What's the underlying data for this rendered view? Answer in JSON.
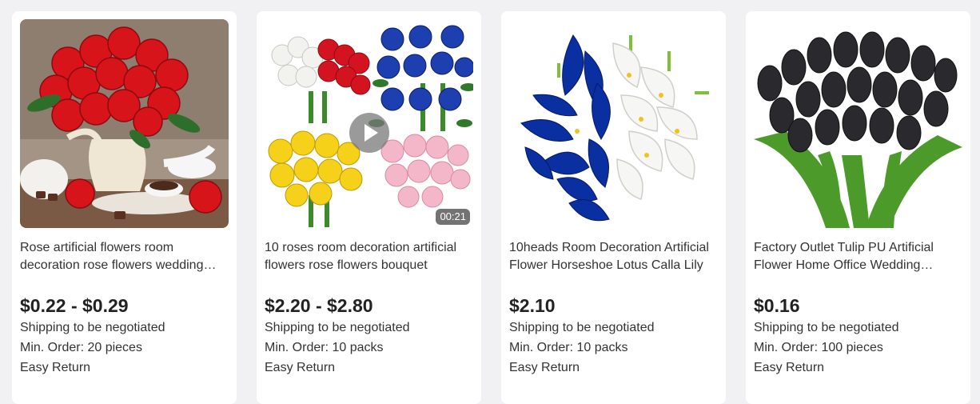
{
  "products": [
    {
      "title": "Rose artificial flowers room decoration rose flowers wedding decoration",
      "price": "$0.22 - $0.29",
      "shipping": "Shipping to be negotiated",
      "min_order": "Min. Order: 20 pieces",
      "returns": "Easy Return",
      "image": "red-roses-vase-photo"
    },
    {
      "title": "10 roses room decoration artificial flowers rose flowers bouquet",
      "price": "$2.20 - $2.80",
      "shipping": "Shipping to be negotiated",
      "min_order": "Min. Order: 10 packs",
      "returns": "Easy Return",
      "image": "rose-bouquets-collage-video",
      "video_duration": "00:21"
    },
    {
      "title": "10heads Room Decoration Artificial Flower Horseshoe Lotus Calla Lily",
      "price": "$2.10",
      "shipping": "Shipping to be negotiated",
      "min_order": "Min. Order: 10 packs",
      "returns": "Easy Return",
      "image": "blue-white-calla-lily-bouquet"
    },
    {
      "title": "Factory Outlet Tulip PU Artificial Flower Home Office Wedding Decoration",
      "price": "$0.16",
      "shipping": "Shipping to be negotiated",
      "min_order": "Min. Order: 100 pieces",
      "returns": "Easy Return",
      "image": "black-tulips-bouquet"
    }
  ],
  "colors": {
    "page_bg": "#f1f1f3",
    "card_bg": "#ffffff",
    "rose_red": "#d7141a",
    "royal_blue": "#0a2fa0",
    "tulip_black": "#2a2a2e",
    "stem_green": "#4c9a2a"
  }
}
